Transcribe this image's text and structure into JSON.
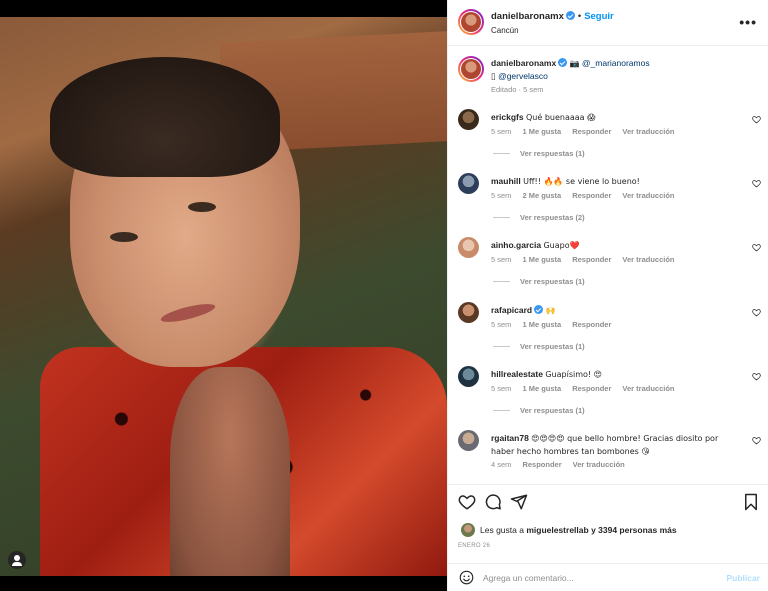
{
  "header": {
    "username": "danielbaronamx",
    "follow_label": "Seguir",
    "location": "Cancún",
    "separator": "•",
    "more": "•••"
  },
  "caption": {
    "username": "danielbaronamx",
    "camera": "📷",
    "mention1": "@_marianoramos",
    "bullet": "▯",
    "mention2": "@gervelasco",
    "edited": "Editado · 5 sem"
  },
  "comments": [
    {
      "username": "erickgfs",
      "text": "Qué buenaaaa 😱",
      "time": "5 sem",
      "likes": "1 Me gusta",
      "reply": "Responder",
      "translate": "Ver traducción",
      "replies": "Ver respuestas (1)"
    },
    {
      "username": "mauhill",
      "text": "Uff!! 🔥🔥 se viene lo bueno!",
      "time": "5 sem",
      "likes": "2 Me gusta",
      "reply": "Responder",
      "translate": "Ver traducción",
      "replies": "Ver respuestas (2)"
    },
    {
      "username": "ainho.garcia",
      "text": "Guapo❤️",
      "time": "5 sem",
      "likes": "1 Me gusta",
      "reply": "Responder",
      "translate": "Ver traducción",
      "replies": "Ver respuestas (1)"
    },
    {
      "username": "rafapicard",
      "text": "🙌",
      "time": "5 sem",
      "likes": "1 Me gusta",
      "reply": "Responder",
      "translate": "",
      "replies": "Ver respuestas (1)"
    },
    {
      "username": "hillrealestate",
      "text": "Guapísimo! 😍",
      "time": "5 sem",
      "likes": "1 Me gusta",
      "reply": "Responder",
      "translate": "Ver traducción",
      "replies": "Ver respuestas (1)"
    },
    {
      "username": "rgaitan78",
      "text": "😍😍😍😍 que bello hombre! Gracias diosito por haber hecho hombres tan bombones 😘",
      "time": "4 sem",
      "likes": "",
      "reply": "Responder",
      "translate": "Ver traducción",
      "replies": ""
    }
  ],
  "likes": {
    "prefix": "Les gusta a",
    "user": "miguelestrellab",
    "suffix": "y 3394 personas más"
  },
  "date": "ENERO 26",
  "composer": {
    "placeholder": "Agrega un comentario...",
    "publish": "Publicar"
  },
  "colors": {
    "accent": "#0095f6",
    "verified": "#3897f0",
    "muted": "#8e8e8e"
  }
}
